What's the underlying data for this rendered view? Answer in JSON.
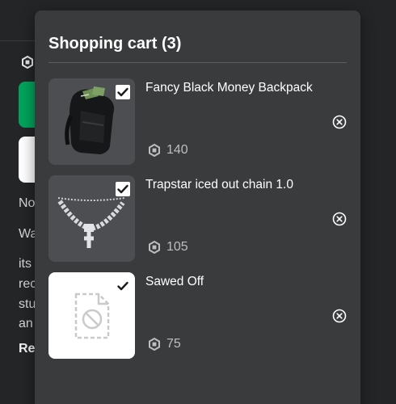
{
  "cart": {
    "title": "Shopping cart (3)",
    "items": [
      {
        "name": "Fancy Black Money Backpack",
        "price": "140",
        "checked": true,
        "thumbnail": "backpack-thumbnail"
      },
      {
        "name": "Trapstar iced out chain 1.0",
        "price": "105",
        "checked": true,
        "thumbnail": "chain-thumbnail"
      },
      {
        "name": "Sawed Off",
        "price": "75",
        "checked": true,
        "thumbnail": "missing-image-placeholder"
      }
    ]
  },
  "icons": {
    "currency": "robux-icon",
    "remove": "close-circle-icon",
    "check": "checkmark-icon"
  },
  "background": {
    "text_fragments": [
      "No",
      "Wa",
      "its",
      "rec",
      "stu",
      "an",
      "Re"
    ]
  },
  "colors": {
    "panel": "#393b3d",
    "page": "#232527",
    "accent_green": "#00a35c"
  }
}
